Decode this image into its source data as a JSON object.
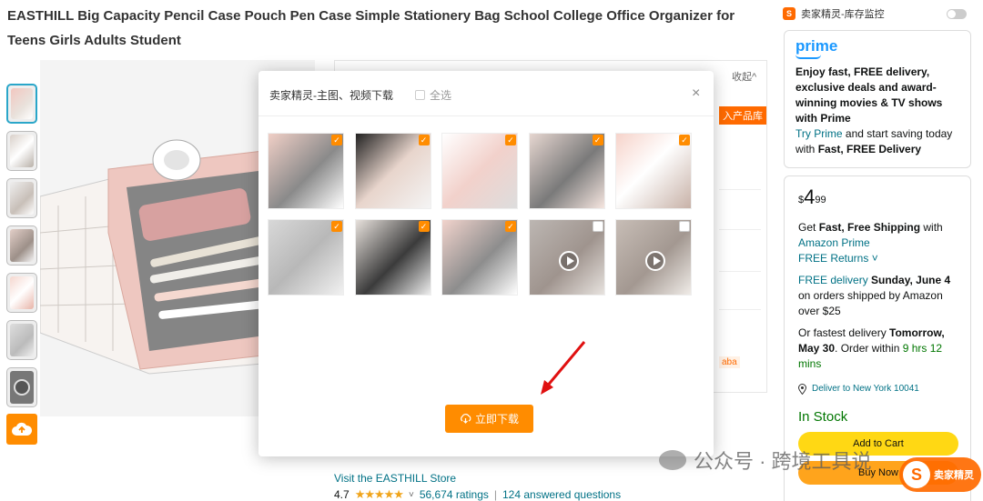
{
  "product": {
    "title": "EASTHILL Big Capacity Pencil Case Pouch Pen Case Simple Stationery Bag School College Office Organizer for Teens Girls Adults Student"
  },
  "store": {
    "link": "Visit the EASTHILL Store",
    "rating": "4.7",
    "stars": "★★★★★",
    "ratings_count": "56,674 ratings",
    "separator": "|",
    "questions": "124 answered questions"
  },
  "plugin": {
    "collapse": "收起^",
    "add_to_library": "入产品库",
    "aba_tag": "aba"
  },
  "modal": {
    "title": "卖家精灵-主图、视频下载",
    "select_all": "全选",
    "close": "×",
    "download_label": "立即下载",
    "images": [
      {
        "checked": true,
        "video": false
      },
      {
        "checked": true,
        "video": false
      },
      {
        "checked": true,
        "video": false
      },
      {
        "checked": true,
        "video": false
      },
      {
        "checked": true,
        "video": false
      },
      {
        "checked": true,
        "video": false
      },
      {
        "checked": true,
        "video": false
      },
      {
        "checked": true,
        "video": false
      },
      {
        "checked": false,
        "video": true
      },
      {
        "checked": false,
        "video": true
      }
    ]
  },
  "monitor": {
    "label": "卖家精灵-库存监控"
  },
  "prime": {
    "logo": "prime",
    "headline": "Enjoy fast, FREE delivery, exclusive deals and award-winning movies & TV shows with Prime",
    "try_link": "Try Prime",
    "rest": " and start saving today with ",
    "rest_bold": "Fast, FREE Delivery"
  },
  "buy_box": {
    "currency": "$",
    "price_whole": "4",
    "price_frac": "99",
    "shipping_pre": "Get ",
    "shipping_bold": "Fast, Free Shipping",
    "shipping_post": " with ",
    "amazon_prime": "Amazon Prime",
    "free_returns": "FREE Returns ˅",
    "free_delivery": "FREE delivery",
    "delivery_date": " Sunday, June 4",
    "delivery_note": "on orders shipped by Amazon over $25",
    "fastest_pre": "Or fastest delivery ",
    "fastest_bold": "Tomorrow, May 30",
    "order_within": ". Order within ",
    "countdown": "9 hrs 12 mins",
    "deliver_to": "Deliver to New York 10041",
    "stock": "In Stock",
    "add_to_cart": "Add to Cart",
    "buy_now": "Buy Now"
  },
  "watermark": {
    "text": "公众号 · 跨境工具说",
    "badge": "卖家精灵",
    "badge_letter": "S"
  },
  "colors": {
    "accent_orange": "#ff8c00",
    "link_teal": "#007185",
    "prime_blue": "#1a98ff",
    "cart_yellow": "#ffd814",
    "buy_orange": "#ffa41c",
    "stock_green": "#007600",
    "arrow_red": "#e01010"
  }
}
